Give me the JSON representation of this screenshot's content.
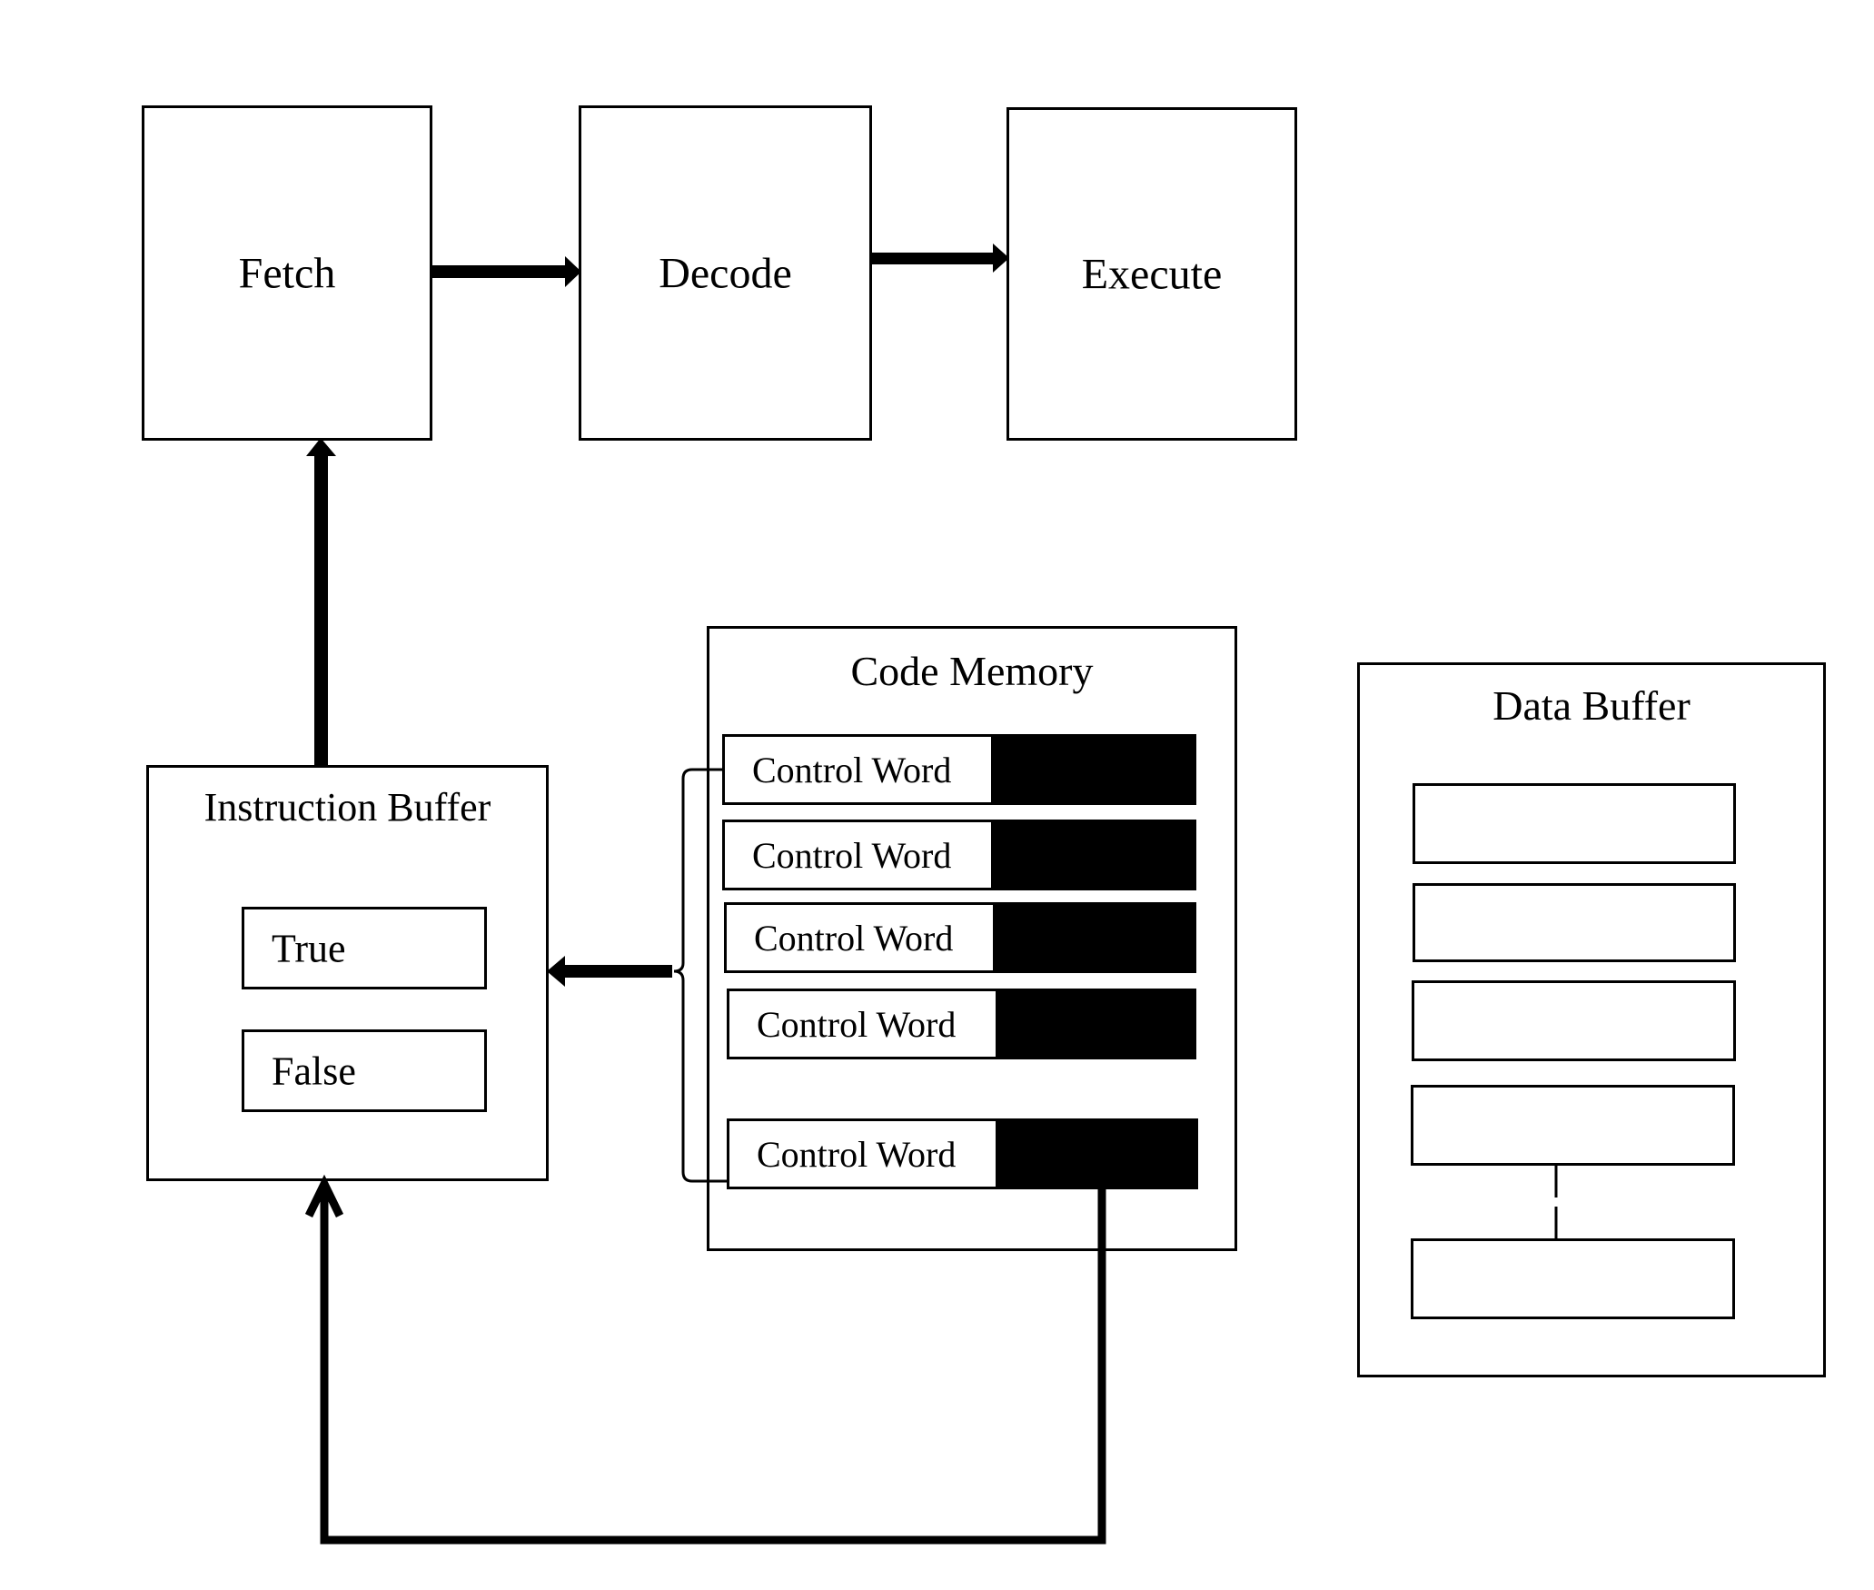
{
  "pipeline": {
    "stages": [
      {
        "label": "Fetch"
      },
      {
        "label": "Decode"
      },
      {
        "label": "Execute"
      }
    ]
  },
  "instruction_buffer": {
    "title": "Instruction Buffer",
    "entries": [
      {
        "label": "True"
      },
      {
        "label": "False"
      }
    ]
  },
  "code_memory": {
    "title": "Code Memory",
    "rows": [
      {
        "label": "Control Word"
      },
      {
        "label": "Control Word"
      },
      {
        "label": "Control Word"
      },
      {
        "label": "Control Word"
      },
      {
        "label": "Control Word"
      }
    ]
  },
  "data_buffer": {
    "title": "Data Buffer",
    "slot_count": 5
  },
  "colors": {
    "line": "#000000",
    "background": "#ffffff"
  }
}
